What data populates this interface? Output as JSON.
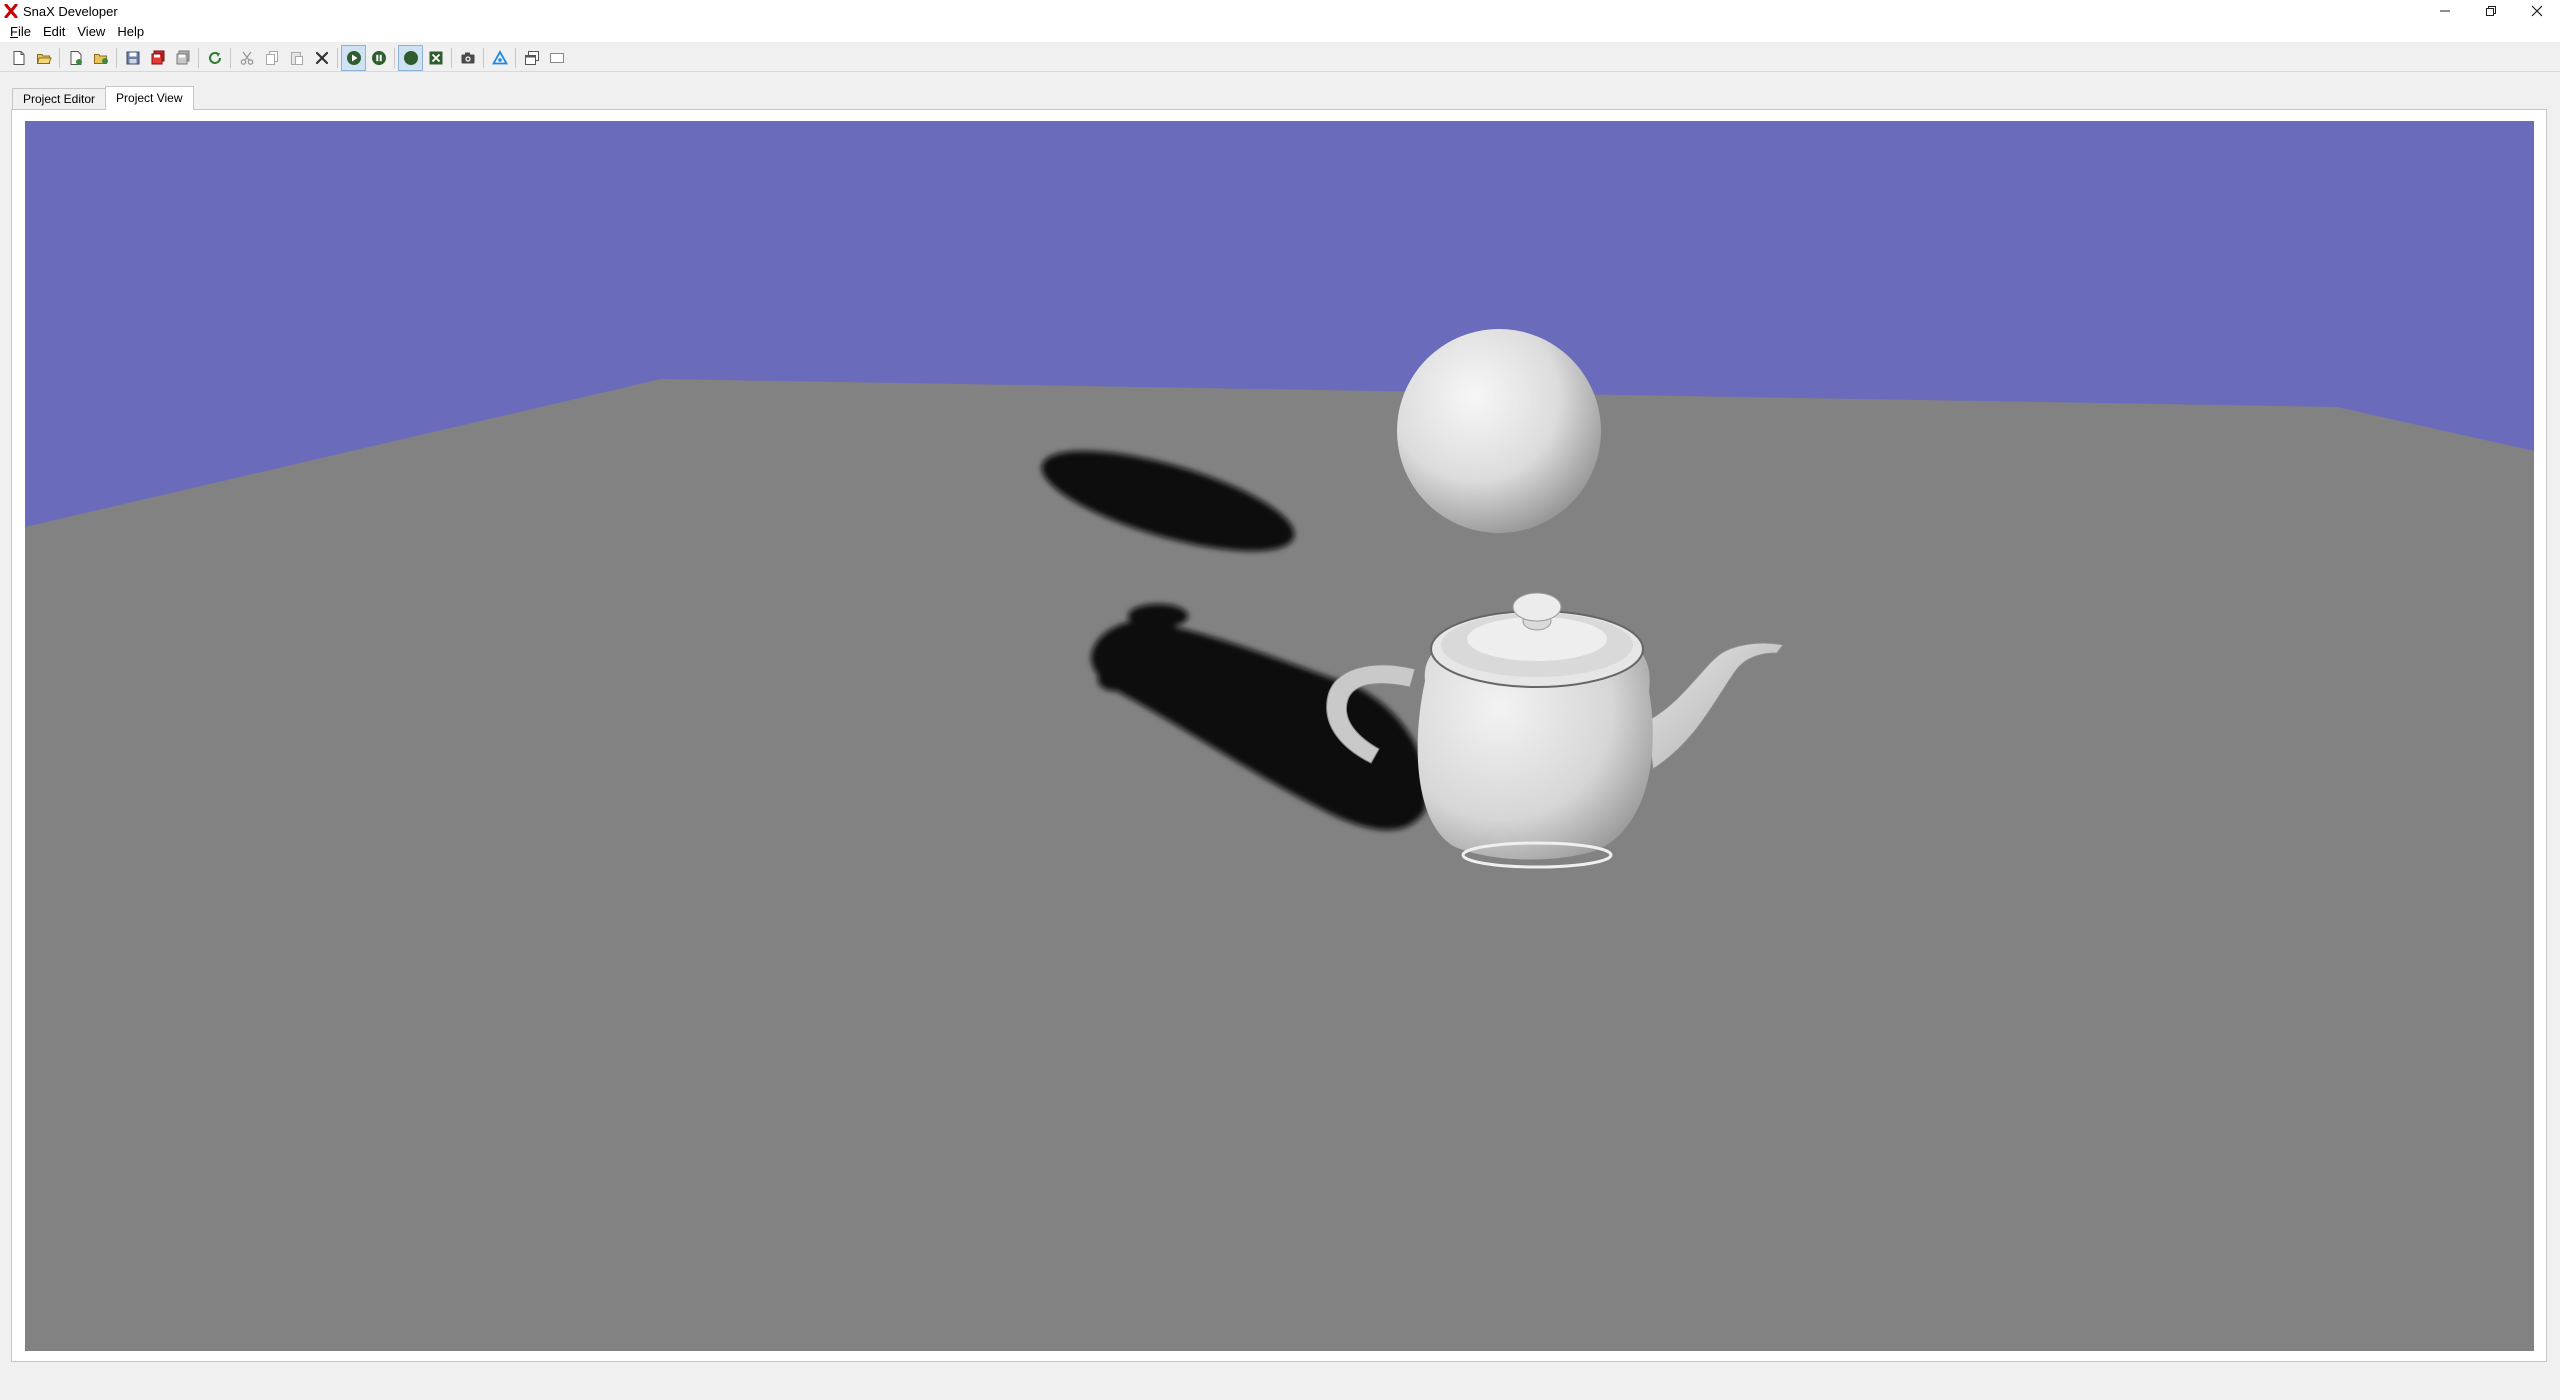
{
  "window": {
    "title": "SnaX Developer",
    "controls": [
      {
        "name": "minimize-button",
        "icon": "minimize-icon"
      },
      {
        "name": "restore-button",
        "icon": "restore-icon"
      },
      {
        "name": "close-button",
        "icon": "close-icon"
      }
    ]
  },
  "menu": {
    "file": {
      "accel": "F",
      "rest": "ile"
    },
    "edit": {
      "label": "Edit"
    },
    "view": {
      "label": "View"
    },
    "help": {
      "label": "Help"
    }
  },
  "toolbar": {
    "buttons": [
      "new-file-icon",
      "open-folder-icon",
      "new-project-icon",
      "open-project-icon",
      "save-icon",
      "save-all-icon",
      "save-copy-icon",
      "refresh-icon",
      "cut-icon",
      "copy-icon",
      "paste-icon",
      "delete-icon",
      "play-icon",
      "pause-icon",
      "record-icon",
      "excel-icon",
      "camera-icon",
      "shader-icon",
      "window-icon",
      "fullscreen-icon"
    ],
    "pressed": [
      "play-icon",
      "record-icon"
    ]
  },
  "tabs": [
    {
      "label": "Project Editor",
      "active": false
    },
    {
      "label": "Project View",
      "active": true
    }
  ],
  "scene": {
    "sky_color": "#6b6bbc",
    "floor_color": "#828282",
    "objects": [
      "sphere",
      "teapot"
    ]
  },
  "colors": {
    "accent_green": "#2f5d2f",
    "logo_red": "#cc0000"
  }
}
